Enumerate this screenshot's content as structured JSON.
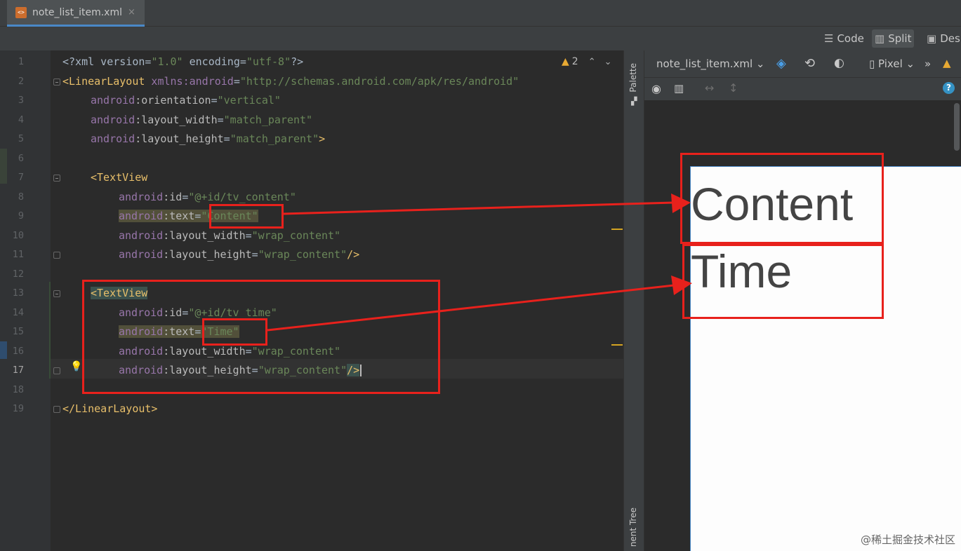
{
  "tab": {
    "filename": "note_list_item.xml",
    "close": "×"
  },
  "modes": {
    "code": "Code",
    "split": "Split",
    "design": "Desi"
  },
  "editor": {
    "warnings_count": "2",
    "line_numbers": [
      "1",
      "2",
      "3",
      "4",
      "5",
      "6",
      "7",
      "8",
      "9",
      "10",
      "11",
      "12",
      "13",
      "14",
      "15",
      "16",
      "17",
      "18",
      "19"
    ],
    "lines": {
      "l1": {
        "a": "<?xml version=",
        "b": "\"1.0\"",
        "c": " encoding=",
        "d": "\"utf-8\"",
        "e": "?>"
      },
      "l2": {
        "tag": "<LinearLayout",
        "ns": " xmlns:android",
        "eq": "=",
        "val": "\"http://schemas.android.com/apk/res/android\""
      },
      "l3": {
        "ns": "android",
        "attr": ":orientation",
        "eq": "=",
        "val": "\"vertical\""
      },
      "l4": {
        "ns": "android",
        "attr": ":layout_width",
        "eq": "=",
        "val": "\"match_parent\""
      },
      "l5": {
        "ns": "android",
        "attr": ":layout_height",
        "eq": "=",
        "val": "\"match_parent\"",
        "end": ">"
      },
      "l7": {
        "tag": "<TextView"
      },
      "l8": {
        "ns": "android",
        "attr": ":id",
        "eq": "=",
        "val": "\"@+id/tv_content\""
      },
      "l9": {
        "ns": "android",
        "attr": ":text",
        "eq": "=",
        "val": "\"Content\""
      },
      "l10": {
        "ns": "android",
        "attr": ":layout_width",
        "eq": "=",
        "val": "\"wrap_content\""
      },
      "l11": {
        "ns": "android",
        "attr": ":layout_height",
        "eq": "=",
        "val": "\"wrap_content\"",
        "end": "/>"
      },
      "l13": {
        "tag": "<TextView"
      },
      "l14": {
        "ns": "android",
        "attr": ":id",
        "eq": "=",
        "val": "\"@+id/tv_time\""
      },
      "l15": {
        "ns": "android",
        "attr": ":text",
        "eq": "=",
        "val": "\"Time\""
      },
      "l16": {
        "ns": "android",
        "attr": ":layout_width",
        "eq": "=",
        "val": "\"wrap_content\""
      },
      "l17": {
        "ns": "android",
        "attr": ":layout_height",
        "eq": "=",
        "val": "\"wrap_content\"",
        "end": "/>"
      },
      "l19": {
        "tag": "</LinearLayout>"
      }
    }
  },
  "side_panels": {
    "palette": "Palette",
    "component_tree": "nent Tree"
  },
  "design": {
    "file_select": "note_list_item.xml",
    "device": "Pixel",
    "more": "»"
  },
  "preview": {
    "content": "Content",
    "time": "Time"
  },
  "watermark": "@稀土掘金技术社区",
  "colors": {
    "annotation": "#e8211c",
    "tab_underline": "#4a88c7"
  }
}
